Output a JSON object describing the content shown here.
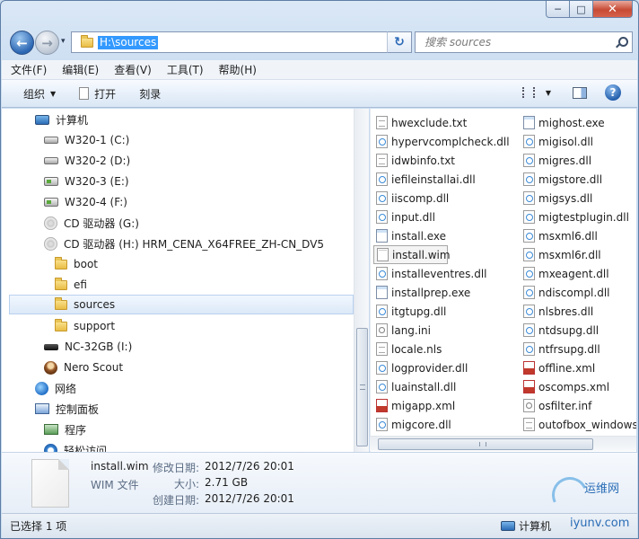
{
  "window": {
    "minimize": "─",
    "maximize": "□",
    "close": "✕"
  },
  "nav": {
    "back": "←",
    "forward": "→",
    "dropdown": "▾",
    "refresh": "↻",
    "address": "H:\\sources",
    "search_placeholder": "搜索 sources"
  },
  "menu": [
    "文件(F)",
    "编辑(E)",
    "查看(V)",
    "工具(T)",
    "帮助(H)"
  ],
  "toolbar": {
    "organize": "组织",
    "open": "打开",
    "burn": "刻录",
    "help": "?"
  },
  "tree": [
    {
      "label": "计算机",
      "icon": "computer-icon"
    },
    {
      "label": "W320-1 (C:)",
      "icon": "drive-icon"
    },
    {
      "label": "W320-2 (D:)",
      "icon": "drive-icon"
    },
    {
      "label": "W320-3 (E:)",
      "icon": "drive-icon"
    },
    {
      "label": "W320-4 (F:)",
      "icon": "drive-icon"
    },
    {
      "label": "CD 驱动器 (G:)",
      "icon": "cd-icon"
    },
    {
      "label": "CD 驱动器 (H:) HRM_CENA_X64FREE_ZH-CN_DV5",
      "icon": "cd-icon"
    },
    {
      "label": "boot",
      "icon": "folder-icon"
    },
    {
      "label": "efi",
      "icon": "folder-icon"
    },
    {
      "label": "sources",
      "icon": "folder-icon",
      "selected": true
    },
    {
      "label": "support",
      "icon": "folder-icon"
    },
    {
      "label": "NC-32GB (I:)",
      "icon": "usb-icon"
    },
    {
      "label": "Nero Scout",
      "icon": "nero-icon"
    },
    {
      "label": "网络",
      "icon": "network-icon"
    },
    {
      "label": "控制面板",
      "icon": "control-panel-icon"
    },
    {
      "label": "程序",
      "icon": "programs-icon"
    },
    {
      "label": "轻松访问",
      "icon": "accessibility-icon"
    }
  ],
  "files_col1": [
    {
      "name": "hwexclude.txt",
      "type": "txt"
    },
    {
      "name": "hypervcomplcheck.dll",
      "type": "dll"
    },
    {
      "name": "idwbinfo.txt",
      "type": "txt"
    },
    {
      "name": "iefileinstallai.dll",
      "type": "dll"
    },
    {
      "name": "iiscomp.dll",
      "type": "dll"
    },
    {
      "name": "input.dll",
      "type": "dll"
    },
    {
      "name": "install.exe",
      "type": "exe"
    },
    {
      "name": "install.wim",
      "type": "wim",
      "selected": true
    },
    {
      "name": "installeventres.dll",
      "type": "dll"
    },
    {
      "name": "installprep.exe",
      "type": "exe"
    },
    {
      "name": "itgtupg.dll",
      "type": "dll"
    },
    {
      "name": "lang.ini",
      "type": "ini"
    },
    {
      "name": "locale.nls",
      "type": "nls"
    },
    {
      "name": "logprovider.dll",
      "type": "dll"
    },
    {
      "name": "luainstall.dll",
      "type": "dll"
    },
    {
      "name": "migapp.xml",
      "type": "xml"
    },
    {
      "name": "migcore.dll",
      "type": "dll"
    }
  ],
  "files_col2": [
    {
      "name": "mighost.exe",
      "type": "exe"
    },
    {
      "name": "migisol.dll",
      "type": "dll"
    },
    {
      "name": "migres.dll",
      "type": "dll"
    },
    {
      "name": "migstore.dll",
      "type": "dll"
    },
    {
      "name": "migsys.dll",
      "type": "dll"
    },
    {
      "name": "migtestplugin.dll",
      "type": "dll"
    },
    {
      "name": "msxml6.dll",
      "type": "dll"
    },
    {
      "name": "msxml6r.dll",
      "type": "dll"
    },
    {
      "name": "mxeagent.dll",
      "type": "dll"
    },
    {
      "name": "ndiscompl.dll",
      "type": "dll"
    },
    {
      "name": "nlsbres.dll",
      "type": "dll"
    },
    {
      "name": "ntdsupg.dll",
      "type": "dll"
    },
    {
      "name": "ntfrsupg.dll",
      "type": "dll"
    },
    {
      "name": "offline.xml",
      "type": "xml"
    },
    {
      "name": "oscomps.xml",
      "type": "xml"
    },
    {
      "name": "osfilter.inf",
      "type": "ini"
    },
    {
      "name": "outofbox_windows",
      "type": "txt"
    }
  ],
  "details": {
    "name": "install.wim",
    "type": "WIM 文件",
    "modified_label": "修改日期:",
    "modified": "2012/7/26 20:01",
    "size_label": "大小:",
    "size": "2.71 GB",
    "created_label": "创建日期:",
    "created": "2012/7/26 20:01"
  },
  "watermark": {
    "cn": "运维网",
    "en": "iyunv.com"
  },
  "status": {
    "selected": "已选择 1 项",
    "location": "计算机"
  }
}
